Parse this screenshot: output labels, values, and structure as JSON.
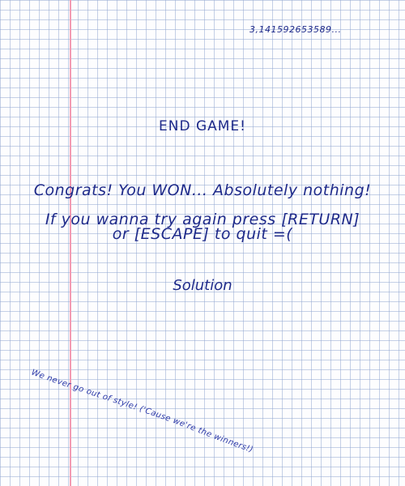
{
  "game": {
    "pi_digits": "3,141592653589...",
    "title": "END GAME!",
    "message": "Congrats! You WON... Absolutely nothing!",
    "instructions_line1": "If you wanna try again press [RETURN]",
    "instructions_line2": "or [ESCAPE] to quit =(",
    "solution_label": "Solution",
    "tagline": "We never go out of style! ('Cause we're the winners!)"
  },
  "colors": {
    "ink": "#1e2a8a",
    "grid": "#96aad2",
    "margin_line": "#f39bb2",
    "paper": "#fdfdfe"
  }
}
